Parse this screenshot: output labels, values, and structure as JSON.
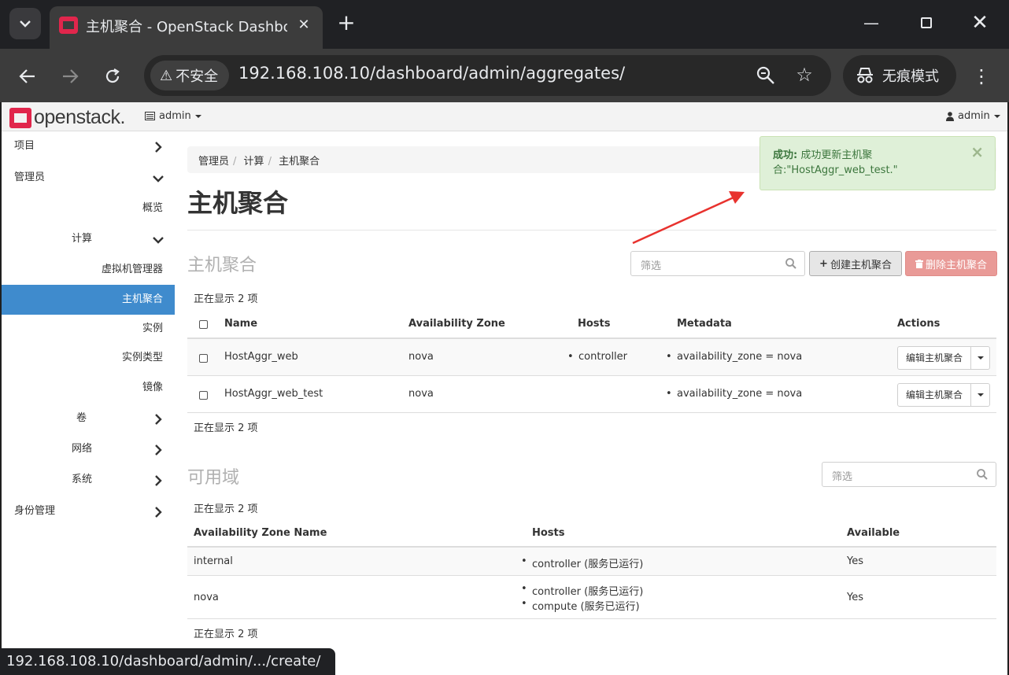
{
  "browser": {
    "tab_title": "主机聚合 - OpenStack Dashboard",
    "insecure_label": "不安全",
    "url": "192.168.108.10/dashboard/admin/aggregates/",
    "incognito_label": "无痕模式",
    "status_url": "192.168.108.10/dashboard/admin/.../create/"
  },
  "topnav": {
    "logo_text": "openstack.",
    "project": "admin",
    "user": "admin"
  },
  "sidebar": {
    "project": "项目",
    "admin": "管理员",
    "overview": "概览",
    "compute": "计算",
    "hypervisors": "虚拟机管理器",
    "aggregates": "主机聚合",
    "instances": "实例",
    "flavors": "实例类型",
    "images": "镜像",
    "volumes": "卷",
    "network": "网络",
    "system": "系统",
    "identity": "身份管理"
  },
  "breadcrumb": [
    "管理员",
    "计算",
    "主机聚合"
  ],
  "page_title": "主机聚合",
  "alert": {
    "prefix": "成功:",
    "message_line1": "成功更新主机聚",
    "message_line2": "合:\"HostAggr_web_test.\""
  },
  "aggregates": {
    "title": "主机聚合",
    "filter_placeholder": "筛选",
    "create_button": "创建主机聚合",
    "delete_button": "删除主机聚合",
    "count_text": "正在显示 2 项",
    "columns": [
      "Name",
      "Availability Zone",
      "Hosts",
      "Metadata",
      "Actions"
    ],
    "rows": [
      {
        "name": "HostAggr_web",
        "zone": "nova",
        "hosts": "controller",
        "metadata": "availability_zone = nova",
        "action": "编辑主机聚合"
      },
      {
        "name": "HostAggr_web_test",
        "zone": "nova",
        "hosts": "",
        "metadata": "availability_zone = nova",
        "action": "编辑主机聚合"
      }
    ]
  },
  "zones": {
    "title": "可用域",
    "filter_placeholder": "筛选",
    "count_text": "正在显示 2 项",
    "columns": [
      "Availability Zone Name",
      "Hosts",
      "Available"
    ],
    "rows": [
      {
        "name": "internal",
        "hosts": [
          "controller (服务已运行)"
        ],
        "available": "Yes"
      },
      {
        "name": "nova",
        "hosts": [
          "controller (服务已运行)",
          "compute (服务已运行)"
        ],
        "available": "Yes"
      }
    ]
  },
  "colors": {
    "accent": "#3f8bcd",
    "danger": "#e99a97",
    "success_bg": "#dff0d8",
    "annotation_arrow": "#e8322e"
  }
}
